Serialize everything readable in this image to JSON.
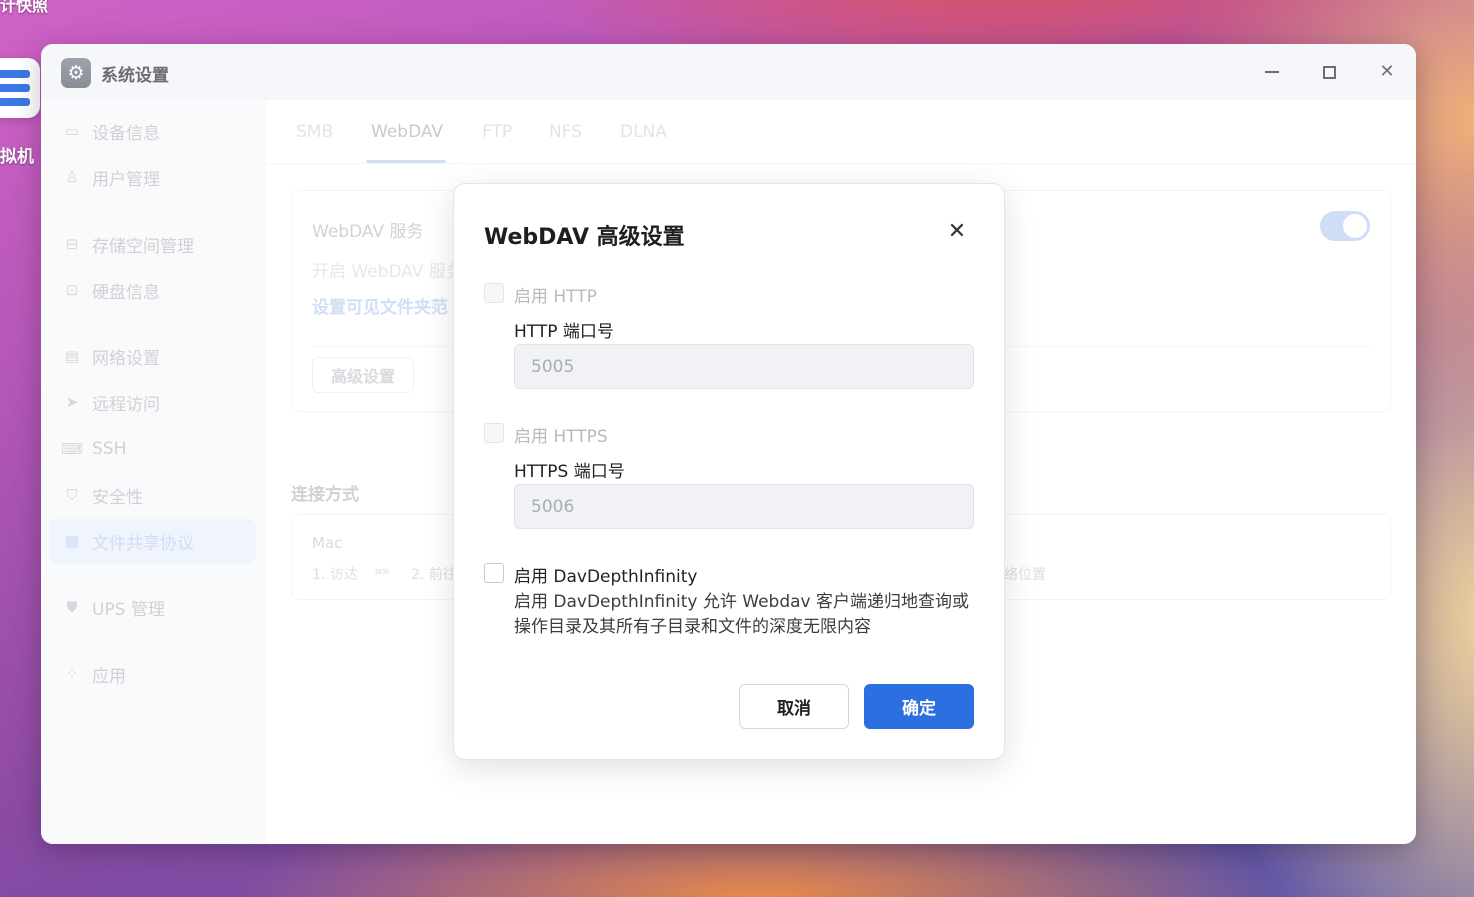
{
  "desktop": {
    "top_text": "计快照",
    "vm_label": "拟机"
  },
  "window": {
    "title": "系统设置",
    "app_icon": "gear-icon"
  },
  "sidebar": {
    "items": [
      {
        "label": "设备信息",
        "icon": "device-icon",
        "active": false
      },
      {
        "label": "用户管理",
        "icon": "user-icon",
        "active": false
      },
      {
        "label": "存储空间管理",
        "icon": "storage-icon",
        "active": false
      },
      {
        "label": "硬盘信息",
        "icon": "disk-icon",
        "active": false
      },
      {
        "label": "网络设置",
        "icon": "network-icon",
        "active": false
      },
      {
        "label": "远程访问",
        "icon": "send-icon",
        "active": false
      },
      {
        "label": "SSH",
        "icon": "terminal-icon",
        "active": false
      },
      {
        "label": "安全性",
        "icon": "shield-check-icon",
        "active": false
      },
      {
        "label": "文件共享协议",
        "icon": "document-icon",
        "active": true
      },
      {
        "label": "UPS 管理",
        "icon": "shield-icon",
        "active": false
      },
      {
        "label": "应用",
        "icon": "apps-icon",
        "active": false
      }
    ]
  },
  "tabs": [
    {
      "label": "SMB"
    },
    {
      "label": "WebDAV"
    },
    {
      "label": "FTP"
    },
    {
      "label": "NFS"
    },
    {
      "label": "DLNA"
    }
  ],
  "service": {
    "title": "WebDAV 服务",
    "description": "开启 WebDAV 服务",
    "link": "设置可见文件夹范",
    "advanced_button": "高级设置",
    "enabled": true
  },
  "connection": {
    "title": "连接方式",
    "os": "Mac",
    "step1": "1. 访达",
    "arrow": "»»",
    "step2": "2. 前往",
    "tail": "络位置"
  },
  "modal": {
    "title": "WebDAV 高级设置",
    "http_checkbox": "启用 HTTP",
    "http_port_label": "HTTP 端口号",
    "http_port_value": "5005",
    "https_checkbox": "启用 HTTPS",
    "https_port_label": "HTTPS 端口号",
    "https_port_value": "5006",
    "depth_checkbox": "启用 DavDepthInfinity",
    "depth_help": "启用 DavDepthInfinity 允许 Webdav 客户端递归地查询或操作目录及其所有子目录和文件的深度无限内容",
    "cancel": "取消",
    "confirm": "确定"
  },
  "colors": {
    "accent": "#2b6fe0",
    "active_nav": "#e8eefa"
  }
}
